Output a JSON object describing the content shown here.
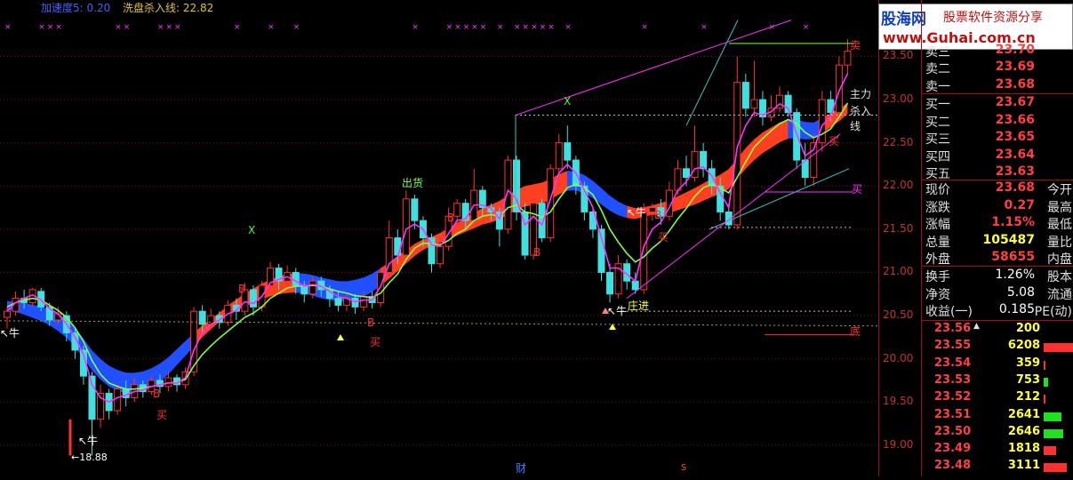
{
  "header": {
    "indicator_name": "加速度5: 0.20",
    "washline_label": "洗盘杀入线: 22.82"
  },
  "logo": {
    "site": "股海网",
    "slogan": "股票软件资源分享",
    "url": "www.Guhai.com.cn"
  },
  "colors": {
    "up": "#ff3030",
    "down": "#40e0e0",
    "ribbon_up": "#ff4020",
    "ribbon_down": "#2050ff",
    "fast_line": "#ff30ff",
    "slow_line": "#80ff40",
    "grid": "#801010"
  },
  "y_axis": {
    "ticks": [
      "23.50",
      "23.00",
      "22.50",
      "22.00",
      "21.50",
      "21.00",
      "20.50",
      "20.00",
      "19.50",
      "19.00"
    ],
    "tick_values": [
      23.5,
      23.0,
      22.5,
      22.0,
      21.5,
      21.0,
      20.5,
      20.0,
      19.5,
      19.0
    ]
  },
  "chart_data": {
    "type": "candlestick",
    "ylim": [
      18.7,
      24.05
    ],
    "candles": [
      [
        20.48,
        20.55,
        20.35,
        20.6
      ],
      [
        20.55,
        20.7,
        20.5,
        20.78
      ],
      [
        20.7,
        20.65,
        20.58,
        20.8
      ],
      [
        20.65,
        20.8,
        20.6,
        20.82
      ],
      [
        20.78,
        20.6,
        20.55,
        20.82
      ],
      [
        20.6,
        20.45,
        20.38,
        20.65
      ],
      [
        20.45,
        20.52,
        20.4,
        20.6
      ],
      [
        20.5,
        20.3,
        20.2,
        20.55
      ],
      [
        20.3,
        20.1,
        20.0,
        20.35
      ],
      [
        20.1,
        19.8,
        19.7,
        20.15
      ],
      [
        19.8,
        19.3,
        18.88,
        19.85
      ],
      [
        19.3,
        19.6,
        19.2,
        19.7
      ],
      [
        19.6,
        19.4,
        19.3,
        19.65
      ],
      [
        19.4,
        19.65,
        19.35,
        19.7
      ],
      [
        19.65,
        19.55,
        19.45,
        19.75
      ],
      [
        19.55,
        19.7,
        19.5,
        19.78
      ],
      [
        19.7,
        19.62,
        19.55,
        19.75
      ],
      [
        19.62,
        19.75,
        19.58,
        19.8
      ],
      [
        19.75,
        19.68,
        19.6,
        19.82
      ],
      [
        19.68,
        19.78,
        19.62,
        19.85
      ],
      [
        19.78,
        19.7,
        19.62,
        19.82
      ],
      [
        19.7,
        19.85,
        19.65,
        19.9
      ],
      [
        19.85,
        20.55,
        19.8,
        20.6
      ],
      [
        20.55,
        20.4,
        20.3,
        20.62
      ],
      [
        20.4,
        20.5,
        20.35,
        20.58
      ],
      [
        20.5,
        20.42,
        20.35,
        20.55
      ],
      [
        20.42,
        20.62,
        20.38,
        20.68
      ],
      [
        20.62,
        20.55,
        20.45,
        20.7
      ],
      [
        20.55,
        20.8,
        20.5,
        20.88
      ],
      [
        20.8,
        20.6,
        20.5,
        20.85
      ],
      [
        20.6,
        20.85,
        20.55,
        20.9
      ],
      [
        20.85,
        21.05,
        20.8,
        21.12
      ],
      [
        21.05,
        20.9,
        20.8,
        21.1
      ],
      [
        20.9,
        21.0,
        20.82,
        21.08
      ],
      [
        21.0,
        20.85,
        20.75,
        21.05
      ],
      [
        20.85,
        20.75,
        20.65,
        20.9
      ],
      [
        20.75,
        20.9,
        20.7,
        20.95
      ],
      [
        20.9,
        20.8,
        20.72,
        20.95
      ],
      [
        20.8,
        20.7,
        20.6,
        20.85
      ],
      [
        20.7,
        20.62,
        20.55,
        20.78
      ],
      [
        20.62,
        20.7,
        20.55,
        20.75
      ],
      [
        20.7,
        20.6,
        20.52,
        20.75
      ],
      [
        20.6,
        20.72,
        20.55,
        20.78
      ],
      [
        20.72,
        20.65,
        20.58,
        20.78
      ],
      [
        20.65,
        21.0,
        20.6,
        21.05
      ],
      [
        21.0,
        21.4,
        20.95,
        21.6
      ],
      [
        21.4,
        21.2,
        21.1,
        21.5
      ],
      [
        21.2,
        21.85,
        21.15,
        21.95
      ],
      [
        21.85,
        21.6,
        21.5,
        21.9
      ],
      [
        21.6,
        21.4,
        21.3,
        21.65
      ],
      [
        21.4,
        21.1,
        21.0,
        21.45
      ],
      [
        21.1,
        21.3,
        21.05,
        21.4
      ],
      [
        21.3,
        21.65,
        21.25,
        21.75
      ],
      [
        21.65,
        21.8,
        21.55,
        21.85
      ],
      [
        21.8,
        21.6,
        21.5,
        21.85
      ],
      [
        21.6,
        21.95,
        21.55,
        22.2
      ],
      [
        21.95,
        21.75,
        21.65,
        22.0
      ],
      [
        21.75,
        21.7,
        21.6,
        21.8
      ],
      [
        21.7,
        21.5,
        21.3,
        21.75
      ],
      [
        21.5,
        22.3,
        21.45,
        22.35
      ],
      [
        22.3,
        21.7,
        21.6,
        22.35
      ],
      [
        21.7,
        21.2,
        21.15,
        21.8
      ],
      [
        21.2,
        21.8,
        21.15,
        21.9
      ],
      [
        21.8,
        21.4,
        21.35,
        21.85
      ],
      [
        21.4,
        22.2,
        21.35,
        22.25
      ],
      [
        22.2,
        22.5,
        22.1,
        22.6
      ],
      [
        22.5,
        22.3,
        22.2,
        22.7
      ],
      [
        22.3,
        22.0,
        21.9,
        22.35
      ],
      [
        22.0,
        21.7,
        21.6,
        22.05
      ],
      [
        21.7,
        21.5,
        21.4,
        21.75
      ],
      [
        21.5,
        21.0,
        20.9,
        21.55
      ],
      [
        21.0,
        20.75,
        20.65,
        21.1
      ],
      [
        20.75,
        21.1,
        20.7,
        21.2
      ],
      [
        21.1,
        20.9,
        20.8,
        21.15
      ],
      [
        20.9,
        20.8,
        20.75,
        21.0
      ],
      [
        20.8,
        21.7,
        20.75,
        21.8
      ],
      [
        21.7,
        21.75,
        21.6,
        21.8
      ],
      [
        21.75,
        21.65,
        21.55,
        21.85
      ],
      [
        21.65,
        21.95,
        21.6,
        22.05
      ],
      [
        21.95,
        22.2,
        21.9,
        22.3
      ],
      [
        22.2,
        22.1,
        22.0,
        22.35
      ],
      [
        22.1,
        22.4,
        22.05,
        22.7
      ],
      [
        22.4,
        22.2,
        22.1,
        22.5
      ],
      [
        22.2,
        22.0,
        21.9,
        22.3
      ],
      [
        22.0,
        21.7,
        21.6,
        22.1
      ],
      [
        21.7,
        21.55,
        21.5,
        21.8
      ],
      [
        21.55,
        23.2,
        21.5,
        23.5
      ],
      [
        23.2,
        22.9,
        22.8,
        23.3
      ],
      [
        22.9,
        23.0,
        22.8,
        23.45
      ],
      [
        23.0,
        22.8,
        22.7,
        23.1
      ],
      [
        22.8,
        22.9,
        22.75,
        23.05
      ],
      [
        22.9,
        23.05,
        22.85,
        23.15
      ],
      [
        23.05,
        22.85,
        22.8,
        23.1
      ],
      [
        22.85,
        22.3,
        22.2,
        22.9
      ],
      [
        22.3,
        22.1,
        22.0,
        22.5
      ],
      [
        22.1,
        22.5,
        22.0,
        22.6
      ],
      [
        22.5,
        23.0,
        22.4,
        23.1
      ],
      [
        23.0,
        22.85,
        22.75,
        23.1
      ],
      [
        22.85,
        23.4,
        22.8,
        23.5
      ],
      [
        23.4,
        23.56,
        23.3,
        23.7
      ]
    ],
    "ribbon_mid": [
      20.62,
      20.6,
      20.58,
      20.55,
      20.52,
      20.48,
      20.42,
      20.35,
      20.25,
      20.12,
      19.98,
      19.88,
      19.8,
      19.75,
      19.72,
      19.72,
      19.74,
      19.78,
      19.84,
      19.92,
      20.02,
      20.12,
      20.22,
      20.32,
      20.4,
      20.48,
      20.56,
      20.62,
      20.68,
      20.73,
      20.78,
      20.82,
      20.85,
      20.87,
      20.88,
      20.87,
      20.85,
      20.82,
      20.8,
      20.78,
      20.78,
      20.8,
      20.83,
      20.88,
      20.95,
      21.02,
      21.1,
      21.18,
      21.26,
      21.32,
      21.36,
      21.4,
      21.45,
      21.5,
      21.55,
      21.6,
      21.65,
      21.68,
      21.72,
      21.78,
      21.84,
      21.88,
      21.9,
      21.92,
      21.96,
      22.02,
      22.06,
      22.06,
      22.02,
      21.96,
      21.88,
      21.8,
      21.74,
      21.7,
      21.68,
      21.7,
      21.72,
      21.74,
      21.76,
      21.8,
      21.84,
      21.88,
      21.93,
      21.98,
      22.02,
      22.08,
      22.2,
      22.32,
      22.42,
      22.5,
      22.56,
      22.62,
      22.66,
      22.66,
      22.64,
      22.64,
      22.7,
      22.76,
      22.82,
      22.9
    ],
    "fast_line": [
      20.55,
      20.65,
      20.7,
      20.74,
      20.68,
      20.58,
      20.52,
      20.4,
      20.25,
      20.05,
      19.7,
      19.55,
      19.5,
      19.55,
      19.58,
      19.62,
      19.64,
      19.68,
      19.7,
      19.72,
      19.72,
      19.78,
      20.1,
      20.3,
      20.4,
      20.45,
      20.52,
      20.56,
      20.66,
      20.64,
      20.72,
      20.88,
      20.92,
      20.95,
      20.9,
      20.84,
      20.86,
      20.84,
      20.78,
      20.72,
      20.7,
      20.66,
      20.68,
      20.68,
      20.84,
      21.1,
      21.18,
      21.5,
      21.56,
      21.5,
      21.32,
      21.3,
      21.45,
      21.6,
      21.62,
      21.78,
      21.78,
      21.74,
      21.62,
      21.95,
      21.85,
      21.55,
      21.65,
      21.55,
      21.85,
      22.15,
      22.25,
      22.15,
      21.95,
      21.75,
      21.4,
      21.05,
      21.05,
      20.98,
      20.9,
      21.3,
      21.5,
      21.58,
      21.75,
      21.95,
      22.05,
      22.2,
      22.22,
      22.12,
      21.92,
      21.75,
      22.45,
      22.7,
      22.85,
      22.82,
      22.86,
      22.95,
      22.9,
      22.6,
      22.35,
      22.42,
      22.7,
      22.8,
      23.1,
      23.3
    ],
    "slow_line": [
      20.6,
      20.65,
      20.68,
      20.7,
      20.68,
      20.62,
      20.56,
      20.48,
      20.36,
      20.2,
      19.98,
      19.82,
      19.72,
      19.68,
      19.65,
      19.65,
      19.66,
      19.68,
      19.7,
      19.72,
      19.73,
      19.76,
      19.92,
      20.05,
      20.15,
      20.24,
      20.32,
      20.4,
      20.48,
      20.53,
      20.6,
      20.7,
      20.76,
      20.82,
      20.84,
      20.84,
      20.85,
      20.84,
      20.81,
      20.78,
      20.76,
      20.73,
      20.72,
      20.71,
      20.76,
      20.88,
      20.98,
      21.15,
      21.28,
      21.34,
      21.33,
      21.32,
      21.37,
      21.45,
      21.5,
      21.6,
      21.65,
      21.67,
      21.65,
      21.75,
      21.78,
      21.7,
      21.68,
      21.64,
      21.7,
      21.85,
      21.98,
      22.02,
      21.98,
      21.9,
      21.72,
      21.5,
      21.35,
      21.22,
      21.12,
      21.18,
      21.28,
      21.36,
      21.48,
      21.62,
      21.74,
      21.88,
      21.98,
      22.02,
      21.98,
      21.92,
      22.1,
      22.28,
      22.45,
      22.55,
      22.64,
      22.72,
      22.77,
      22.72,
      22.62,
      22.56,
      22.6,
      22.66,
      22.8,
      22.96
    ]
  },
  "annotations": {
    "buy": "买",
    "B": "B",
    "bull": "↖牛",
    "low_label": "←18.88",
    "sell_out": "出货",
    "x_mark": "X",
    "zhuang_jin": "庄进",
    "bottom": "底",
    "sell": "卖",
    "main_force": "主力",
    "washline_short": "杀入线",
    "cai": "财",
    "s": "s"
  },
  "quote_panel": {
    "asks": [
      {
        "label": "卖三",
        "price": "23.70"
      },
      {
        "label": "卖二",
        "price": "23.69"
      },
      {
        "label": "卖一",
        "price": "23.68"
      }
    ],
    "bids": [
      {
        "label": "买一",
        "price": "23.67"
      },
      {
        "label": "买二",
        "price": "23.66"
      },
      {
        "label": "买三",
        "price": "23.65"
      },
      {
        "label": "买四",
        "price": "23.64"
      },
      {
        "label": "买五",
        "price": "23.63"
      }
    ],
    "stats": [
      {
        "label": "现价",
        "value": "23.68",
        "label2": "今开",
        "color": "red"
      },
      {
        "label": "涨跌",
        "value": "0.27",
        "label2": "最高",
        "color": "red"
      },
      {
        "label": "涨幅",
        "value": "1.15%",
        "label2": "最低",
        "color": "red"
      },
      {
        "label": "总量",
        "value": "105487",
        "label2": "量比",
        "color": "yellow"
      },
      {
        "label": "外盘",
        "value": "58655",
        "label2": "内盘",
        "color": "red"
      }
    ],
    "fundamentals": [
      {
        "label": "换手",
        "value": "1.26%",
        "label2": "股本"
      },
      {
        "label": "净资",
        "value": "5.08",
        "label2": "流通"
      },
      {
        "label": "收益(一)",
        "value": "0.185",
        "label2": "PE(动)"
      }
    ],
    "ticks": [
      {
        "price": "23.56",
        "volume": "200",
        "bar": 0,
        "arrow": "▲"
      },
      {
        "price": "23.55",
        "volume": "6208",
        "bar": 34,
        "arrow": ""
      },
      {
        "price": "23.54",
        "volume": "359",
        "bar": 2,
        "arrow": ""
      },
      {
        "price": "23.53",
        "volume": "753",
        "bar": 5,
        "arrow": ""
      },
      {
        "price": "23.52",
        "volume": "212",
        "bar": 2,
        "arrow": ""
      },
      {
        "price": "23.51",
        "volume": "2641",
        "bar": 20,
        "arrow": ""
      },
      {
        "price": "23.50",
        "volume": "2646",
        "bar": 22,
        "arrow": ""
      },
      {
        "price": "23.49",
        "volume": "1818",
        "bar": 14,
        "arrow": ""
      },
      {
        "price": "23.48",
        "volume": "3111",
        "bar": 26,
        "arrow": ""
      }
    ]
  }
}
